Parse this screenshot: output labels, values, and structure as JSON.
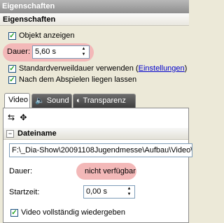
{
  "window": {
    "title": "Eigenschaften"
  },
  "header": {
    "title": "Eigenschaften"
  },
  "object": {
    "show_label": "Objekt anzeigen",
    "show_checked": true
  },
  "duration": {
    "label": "Dauer:",
    "value": "5,60 s"
  },
  "standard_duration": {
    "label": "Standardverweildauer verwenden (",
    "link": "Einstellungen",
    "close": ")",
    "checked": true
  },
  "keep_after_play": {
    "label": "Nach dem Abspielen liegen lassen",
    "checked": true
  },
  "tabs": [
    {
      "label": "Video",
      "active": true
    },
    {
      "label": "Sound",
      "active": false
    },
    {
      "label": "Transparenz",
      "active": false
    }
  ],
  "file": {
    "section_title": "Dateiname",
    "path": "F:\\_Dia-Show\\20091108Jugendmesse\\Aufbau\\Video\\"
  },
  "video_duration": {
    "label": "Dauer:",
    "value": "nicht verfügbar"
  },
  "start_time": {
    "label": "Startzeit:",
    "value": "0,00 s"
  },
  "play_full": {
    "label": "Video vollständig wiedergeben",
    "checked": true
  },
  "colors": {
    "highlight": "#f3b8b8",
    "link": "#0000cc",
    "check": "#21a121"
  }
}
